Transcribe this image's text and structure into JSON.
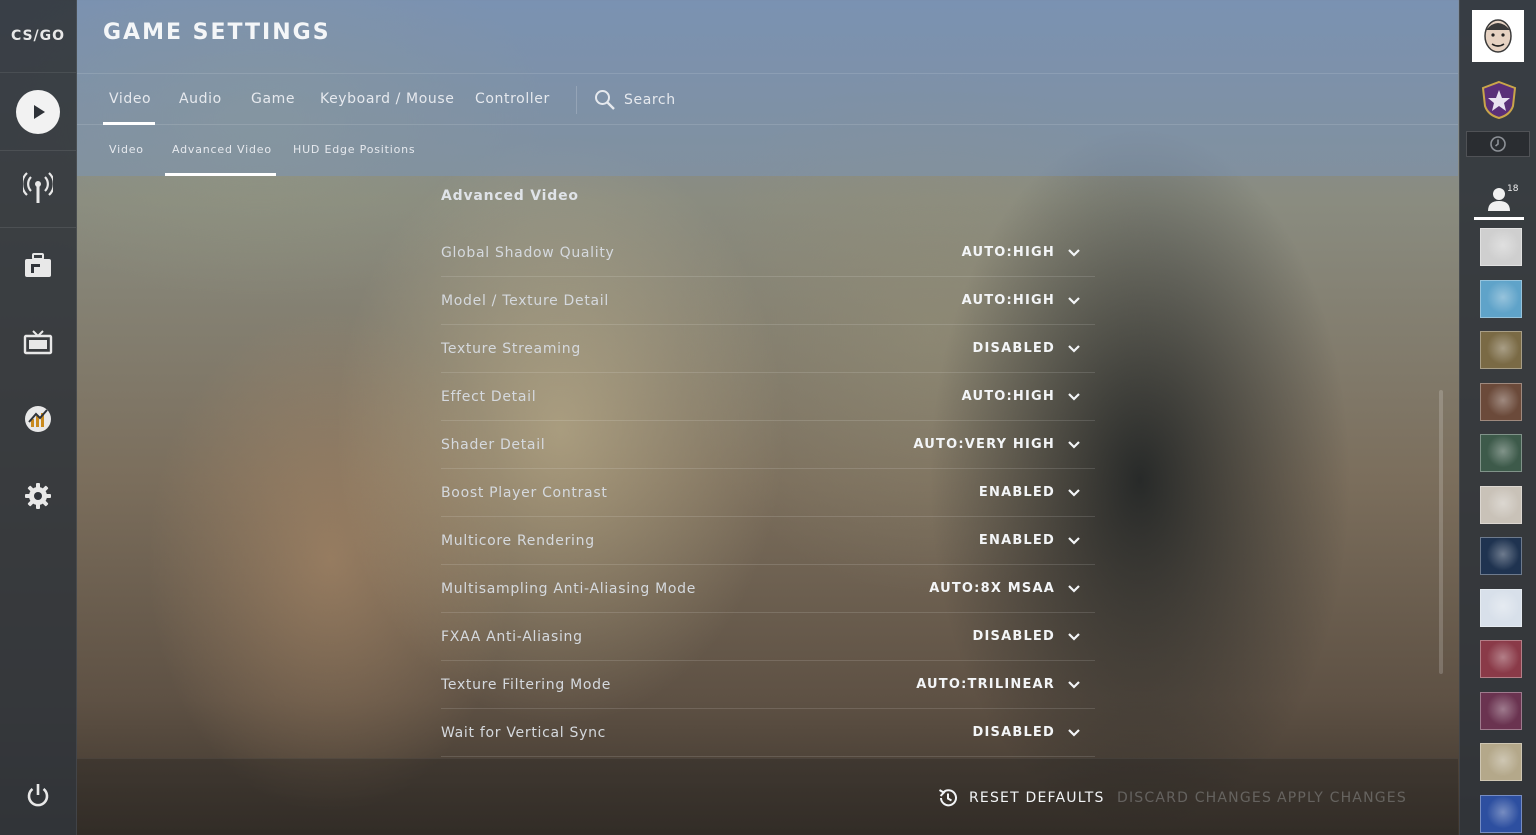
{
  "app": {
    "logo_text": "CS/GO"
  },
  "header": {
    "title": "GAME SETTINGS",
    "tabs": [
      {
        "label": "Video",
        "active": true
      },
      {
        "label": "Audio",
        "active": false
      },
      {
        "label": "Game",
        "active": false
      },
      {
        "label": "Keyboard / Mouse",
        "active": false
      },
      {
        "label": "Controller",
        "active": false
      }
    ],
    "search_label": "Search",
    "subtabs": [
      {
        "label": "Video",
        "active": false
      },
      {
        "label": "Advanced Video",
        "active": true
      },
      {
        "label": "HUD Edge Positions",
        "active": false
      }
    ]
  },
  "left_nav": {
    "icons": [
      "play-icon",
      "broadcast-icon",
      "inventory-icon",
      "watch-tv-icon",
      "stats-icon",
      "settings-gear-icon",
      "power-icon"
    ]
  },
  "section": {
    "title": "Advanced Video",
    "settings": [
      {
        "label": "Global Shadow Quality",
        "value": "AUTO:HIGH"
      },
      {
        "label": "Model / Texture Detail",
        "value": "AUTO:HIGH"
      },
      {
        "label": "Texture Streaming",
        "value": "DISABLED"
      },
      {
        "label": "Effect Detail",
        "value": "AUTO:HIGH"
      },
      {
        "label": "Shader Detail",
        "value": "AUTO:VERY HIGH"
      },
      {
        "label": "Boost Player Contrast",
        "value": "ENABLED"
      },
      {
        "label": "Multicore Rendering",
        "value": "ENABLED"
      },
      {
        "label": "Multisampling Anti-Aliasing Mode",
        "value": "AUTO:8X MSAA"
      },
      {
        "label": "FXAA Anti-Aliasing",
        "value": "DISABLED"
      },
      {
        "label": "Texture Filtering Mode",
        "value": "AUTO:TRILINEAR"
      },
      {
        "label": "Wait for Vertical Sync",
        "value": "DISABLED"
      }
    ]
  },
  "footer": {
    "reset_label": "RESET DEFAULTS",
    "discard_label": "DISCARD CHANGES",
    "apply_label": "APPLY CHANGES"
  },
  "right_rail": {
    "friends_count": "18",
    "friend_avatar_colors": [
      "#cfcfcf",
      "#5fa3c9",
      "#7a6a45",
      "#6b4a3a",
      "#3d5a4a",
      "#c9c2b8",
      "#1f3350",
      "#d8e0ea",
      "#8a3a48",
      "#6a3350",
      "#b4a88a",
      "#2d4fa0"
    ]
  },
  "colors": {
    "accent": "#ffffff",
    "rail_bg": "#30343a",
    "header_tint": "#7896c3"
  }
}
